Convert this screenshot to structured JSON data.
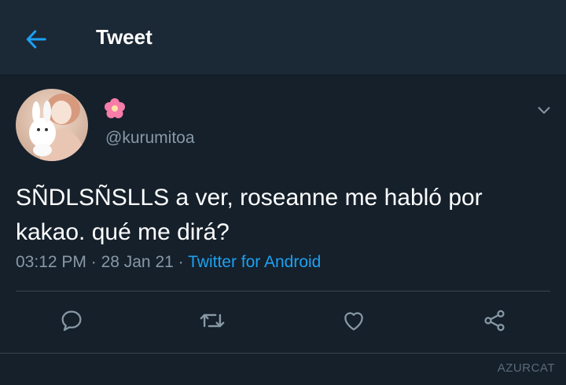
{
  "header": {
    "title": "Tweet",
    "back_icon": "arrow-left-icon"
  },
  "tweet": {
    "display_name_emoji": "flower-emoji",
    "handle": "@kurumitoa",
    "text_line1": "SÑDLSÑSLLS a ver, roseanne me habló por",
    "text_line2": "kakao. qué me dirá?",
    "time": "03:12 PM",
    "sep1": " · ",
    "date": "28 Jan 21",
    "sep2": " · ",
    "source": "Twitter for Android"
  },
  "actions": [
    {
      "icon": "reply-icon"
    },
    {
      "icon": "retweet-icon"
    },
    {
      "icon": "like-icon"
    },
    {
      "icon": "share-icon"
    }
  ],
  "watermark": "AZURCAT",
  "colors": {
    "background": "#15202b",
    "header": "#1b2836",
    "accent": "#1da1f2",
    "secondary_text": "#8899a6",
    "divider": "#38444d"
  }
}
